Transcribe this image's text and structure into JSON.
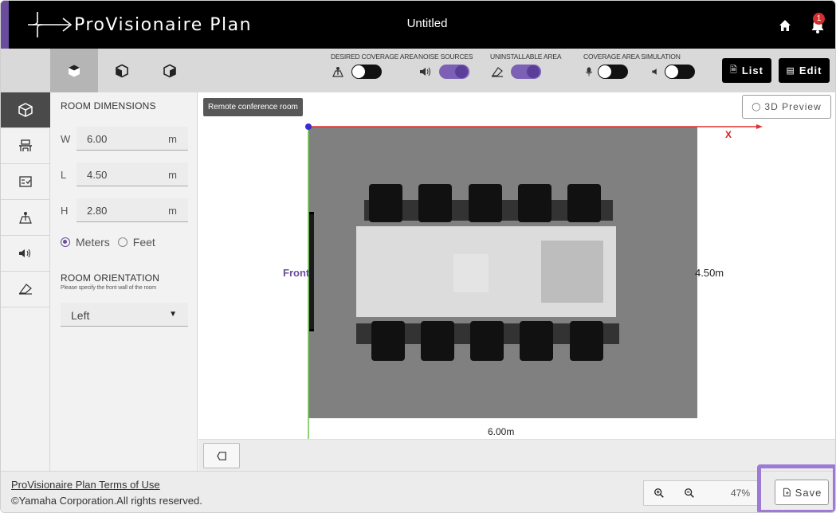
{
  "app": {
    "name": "ProVisionaire Plan",
    "document_title": "Untitled",
    "notification_count": "1"
  },
  "toolbar": {
    "view_tabs": [
      {
        "icon": "cube-top-view-icon",
        "active": true
      },
      {
        "icon": "cube-side-view-icon",
        "active": false
      },
      {
        "icon": "cube-3d-view-icon",
        "active": false
      }
    ],
    "toggles": [
      {
        "label": "DESIRED COVERAGE AREA",
        "icon": "coverage-area-icon",
        "on": false
      },
      {
        "label": "NOISE SOURCES",
        "icon": "noise-source-icon",
        "on": true
      },
      {
        "label": "UNINSTALLABLE AREA",
        "icon": "eraser-icon",
        "on": true
      }
    ],
    "simulation": {
      "label": "COVERAGE AREA SIMULATION",
      "mic_on": false,
      "speaker_on": false
    },
    "list_label": "List",
    "edit_label": "Edit"
  },
  "panel": {
    "room_dimensions_title": "ROOM DIMENSIONS",
    "dimensions": [
      {
        "label": "W",
        "value": "6.00",
        "unit": "m"
      },
      {
        "label": "L",
        "value": "4.50",
        "unit": "m"
      },
      {
        "label": "H",
        "value": "2.80",
        "unit": "m"
      }
    ],
    "units": {
      "meters": "Meters",
      "feet": "Feet",
      "selected": "Meters"
    },
    "orientation_title": "ROOM ORIENTATION",
    "orientation_hint": "Please specify the front wall of the room",
    "orientation_value": "Left"
  },
  "canvas": {
    "room_name": "Remote conference room",
    "preview_label": "3D Preview",
    "x_axis_label": "X",
    "front_label": "Front",
    "width_label": "6.00m",
    "length_label": "4.50m"
  },
  "footer": {
    "terms_link": "ProVisionaire Plan Terms of Use",
    "copyright": "©Yamaha Corporation.All rights reserved.",
    "zoom": "47%",
    "save_label": "Save"
  },
  "colors": {
    "brand_purple": "#6a4c9c",
    "toggle_on": "#7b60b5",
    "room_floor": "#808080",
    "axis_x": "#e03030",
    "axis_y": "#6cc04a"
  }
}
